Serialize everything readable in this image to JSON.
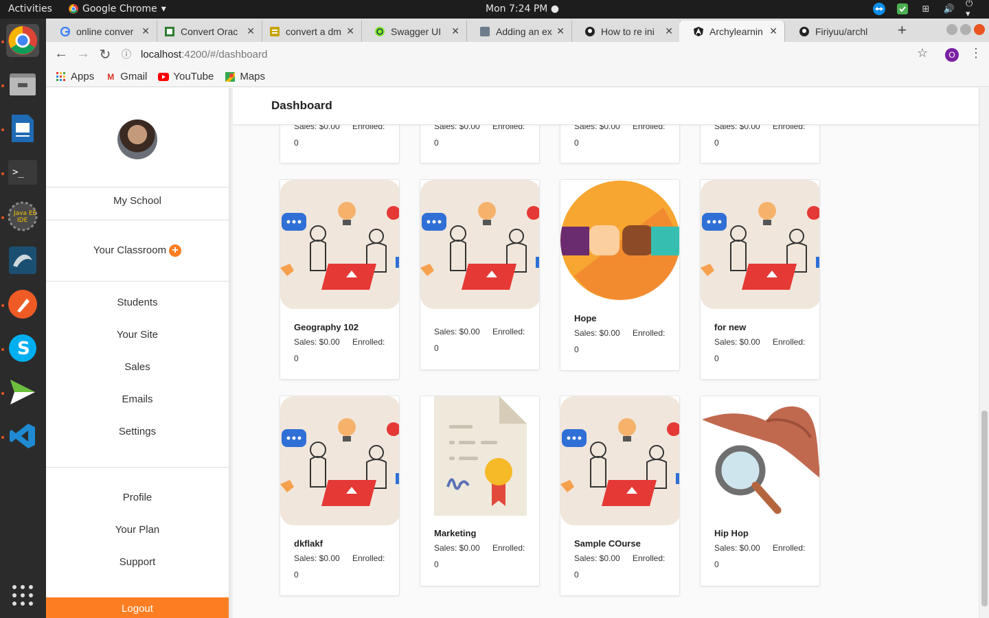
{
  "os": {
    "activities": "Activities",
    "app_name": "Google Chrome",
    "clock": "Mon  7:24 PM"
  },
  "browser": {
    "tabs": [
      {
        "title": "online conver",
        "icon": "google-icon"
      },
      {
        "title": "Convert Orac",
        "icon": "convert-icon"
      },
      {
        "title": "convert a dm",
        "icon": "stack-icon"
      },
      {
        "title": "Swagger UI",
        "icon": "swagger-icon"
      },
      {
        "title": "Adding an ex",
        "icon": "page-icon"
      },
      {
        "title": "How to re ini",
        "icon": "github-icon"
      },
      {
        "title": "Archylearnin",
        "icon": "angular-icon"
      },
      {
        "title": "Firiyuu/archl",
        "icon": "github-icon"
      }
    ],
    "url_host": "localhost",
    "url_path": ":4200/#/dashboard",
    "profile_initial": "O",
    "bookmarks": [
      {
        "label": "Apps",
        "icon": "apps-icon"
      },
      {
        "label": "Gmail",
        "icon": "gmail-icon"
      },
      {
        "label": "YouTube",
        "icon": "youtube-icon"
      },
      {
        "label": "Maps",
        "icon": "maps-icon"
      }
    ]
  },
  "sidebar": {
    "my_school": "My School",
    "classroom": "Your Classroom",
    "nav": [
      "Students",
      "Your Site",
      "Sales",
      "Emails",
      "Settings"
    ],
    "account": [
      "Profile",
      "Your Plan",
      "Support"
    ],
    "logout": "Logout"
  },
  "header": {
    "title": "Dashboard"
  },
  "labels": {
    "sales": "Sales: $0.00",
    "enrolled": "Enrolled:"
  },
  "top_row": [
    {
      "sales": "Sales: $0.00",
      "enrolled": "Enrolled:",
      "count": "0"
    },
    {
      "sales": "Sales: $0.00",
      "enrolled": "Enrolled:",
      "count": "0"
    },
    {
      "sales": "Sales: $0.00",
      "enrolled": "Enrolled:",
      "count": "0"
    },
    {
      "sales": "Sales: $0.00",
      "enrolled": "Enrolled:",
      "count": "0"
    }
  ],
  "courses": [
    {
      "name": "Geography 102",
      "sales": "Sales: $0.00",
      "enrolled": "Enrolled:",
      "count": "0",
      "image": "classroom-illustration"
    },
    {
      "name": "",
      "sales": "Sales: $0.00",
      "enrolled": "Enrolled:",
      "count": "0",
      "image": "classroom-illustration"
    },
    {
      "name": "Hope",
      "sales": "Sales: $0.00",
      "enrolled": "Enrolled:",
      "count": "0",
      "image": "fist-bump-illustration"
    },
    {
      "name": "for new",
      "sales": "Sales: $0.00",
      "enrolled": "Enrolled:",
      "count": "0",
      "image": "classroom-illustration"
    },
    {
      "name": "dkflakf",
      "sales": "Sales: $0.00",
      "enrolled": "Enrolled:",
      "count": "0",
      "image": "classroom-illustration"
    },
    {
      "name": "Marketing",
      "sales": "Sales: $0.00",
      "enrolled": "Enrolled:",
      "count": "0",
      "image": "certificate-illustration"
    },
    {
      "name": "Sample COurse",
      "sales": "Sales: $0.00",
      "enrolled": "Enrolled:",
      "count": "0",
      "image": "classroom-illustration"
    },
    {
      "name": "Hip Hop",
      "sales": "Sales: $0.00",
      "enrolled": "Enrolled:",
      "count": "0",
      "image": "detective-illustration"
    }
  ],
  "colors": {
    "accent": "#fd7e22",
    "ubuntu": "#e95420"
  }
}
